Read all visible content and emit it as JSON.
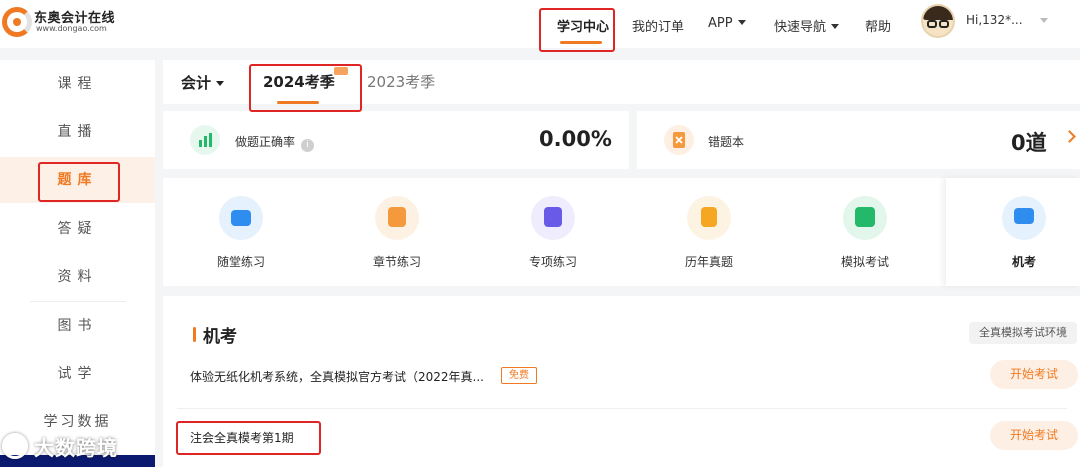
{
  "brand": {
    "name": "东奥会计在线",
    "url": "www.dongao.com",
    "accent": "#f07a23"
  },
  "header": {
    "nav": [
      "学习中心",
      "我的订单",
      "APP",
      "快速导航",
      "帮助"
    ],
    "active_nav": "学习中心",
    "user_name": "Hi,132*..."
  },
  "sidebar": {
    "items": [
      "课程",
      "直播",
      "题库",
      "答疑",
      "资料",
      "图书",
      "试学",
      "学习数据"
    ],
    "active_item": "题库"
  },
  "tabs": {
    "subject": "会计",
    "seasons": [
      "2024考季",
      "2023考季"
    ],
    "active_season": "2024考季"
  },
  "stats": {
    "accuracy_label": "做题正确率",
    "accuracy_info": "i",
    "accuracy_value": "0.00%",
    "wrongbook_label": "错题本",
    "wrongbook_value": "0道"
  },
  "functions": [
    {
      "label": "随堂练习",
      "icon": "video-board-icon",
      "color": "#2f8df0"
    },
    {
      "label": "章节练习",
      "icon": "book-icon",
      "color": "#f59a3c"
    },
    {
      "label": "专项练习",
      "icon": "document-icon",
      "color": "#6a5ae8"
    },
    {
      "label": "历年真题",
      "icon": "exam-paper-icon",
      "color": "#f5a623"
    },
    {
      "label": "模拟考试",
      "icon": "clipboard-icon",
      "color": "#23b86a"
    },
    {
      "label": "机考",
      "icon": "computer-test-icon",
      "color": "#2f8df0"
    }
  ],
  "exam_section": {
    "title": "机考",
    "env_label": "全真模拟考试环境",
    "rows": [
      {
        "title": "体验无纸化机考系统，全真模拟官方考试（2022年真...",
        "tag": "免费",
        "button": "开始考试"
      },
      {
        "title": "注会全真模考第1期",
        "button": "开始考试"
      }
    ]
  },
  "watermark": {
    "text": "大数跨境"
  }
}
